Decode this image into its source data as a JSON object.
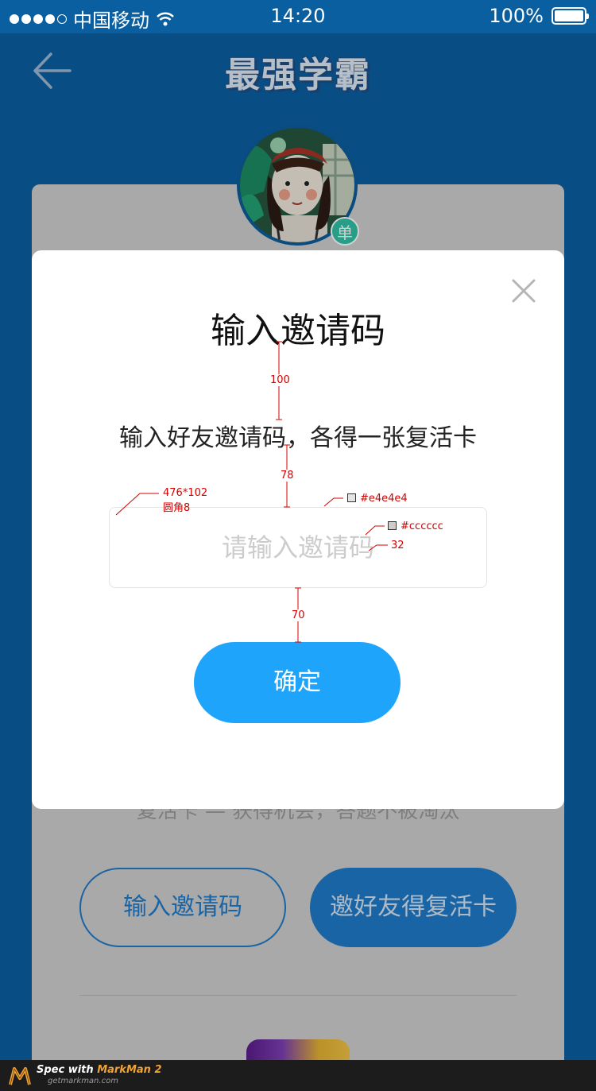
{
  "status_bar": {
    "carrier": "中国移动",
    "time": "14:20",
    "battery": "100%"
  },
  "header": {
    "title": "最强学霸"
  },
  "avatar": {
    "badge": "单"
  },
  "background": {
    "text": "复活卡 — 获得机会，答题不被淘汰",
    "btn_enter_code": "输入邀请码",
    "btn_invite": "邀好友得复活卡"
  },
  "modal": {
    "title": "输入邀请码",
    "subtitle": "输入好友邀请码，各得一张复活卡",
    "input_placeholder": "请输入邀请码",
    "input_value": "",
    "confirm_label": "确定"
  },
  "annotations": {
    "gap_title": "100",
    "gap_sub": "78",
    "box_size": "476*102",
    "box_radius": "圆角8",
    "border_color": "#e4e4e4",
    "placeholder_color": "#cccccc",
    "font_size": "32",
    "gap_button": "70"
  },
  "footer": {
    "line1_prefix": "Spec with ",
    "line1_brand": "MarkMan 2",
    "line2": "getmarkman.com"
  },
  "colors": {
    "page_bg": "#0a5fa0",
    "primary_button": "#1ea5fb",
    "input_border": "#e4e4e4",
    "placeholder": "#cccccc",
    "badge": "#31c1a6"
  }
}
